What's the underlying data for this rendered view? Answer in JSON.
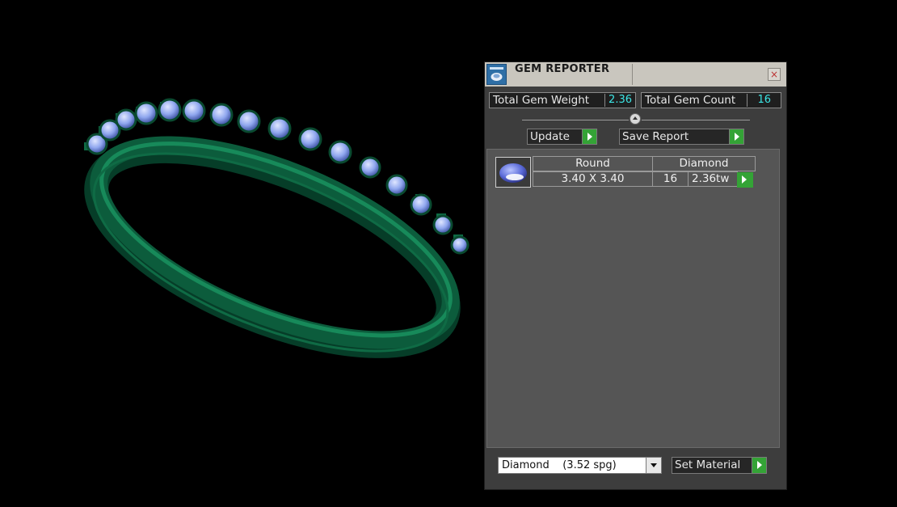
{
  "window": {
    "title": "GEM REPORTER",
    "close_symbol": "×"
  },
  "stats": {
    "total_weight_label": "Total Gem Weight",
    "total_weight_value": "2.36",
    "total_count_label": "Total Gem Count",
    "total_count_value": "16"
  },
  "toolbar": {
    "update_label": "Update",
    "save_report_label": "Save Report"
  },
  "gem_list": [
    {
      "shape": "Round",
      "material": "Diamond",
      "size": "3.40 X 3.40",
      "count": "16",
      "weight": "2.36tw",
      "icon": "round-gem-icon"
    }
  ],
  "material_selector": {
    "value": "Diamond    (3.52 spg)"
  },
  "set_material_label": "Set Material",
  "colors": {
    "accent_green": "#34a336",
    "value_cyan": "#3ce6e6",
    "ring_green": "#0c5c3c",
    "gem_blue": "#8fa6ee"
  },
  "icons": {
    "title": "gem-reporter-icon",
    "close": "close-icon",
    "go": "play-arrow-icon",
    "dropdown": "chevron-down-icon"
  }
}
